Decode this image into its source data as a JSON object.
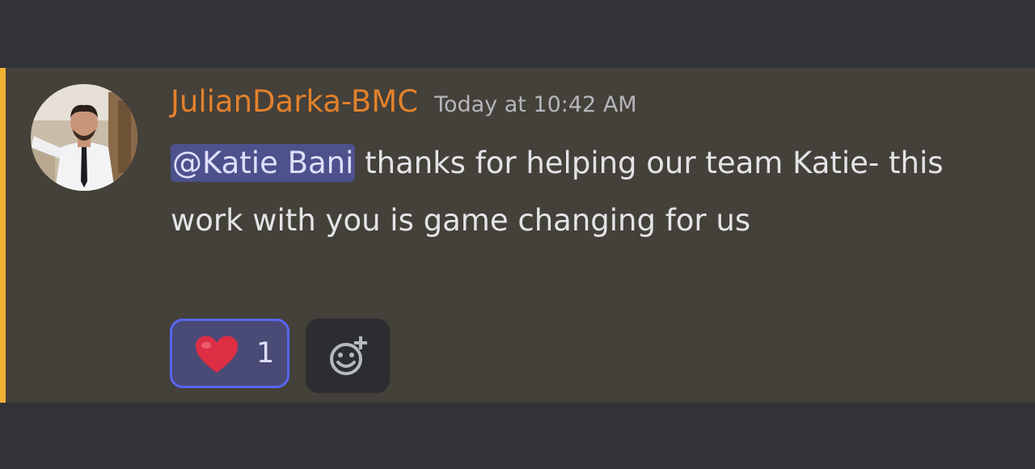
{
  "message": {
    "author": "JulianDarka-BMC",
    "timestamp": "Today at 10:42 AM",
    "mention": "@Katie Bani",
    "text": " thanks for helping our team Katie- this work with you is game changing for us"
  },
  "reactions": [
    {
      "emoji": "heart-emoji",
      "count": "1"
    }
  ],
  "add_reaction_icon": "add-reaction-icon",
  "colors": {
    "author": "#e2812c",
    "mention_bar": "#f0b232",
    "mention_bg": "#5865f2",
    "background": "#313338",
    "highlight_bg": "#44403a"
  }
}
